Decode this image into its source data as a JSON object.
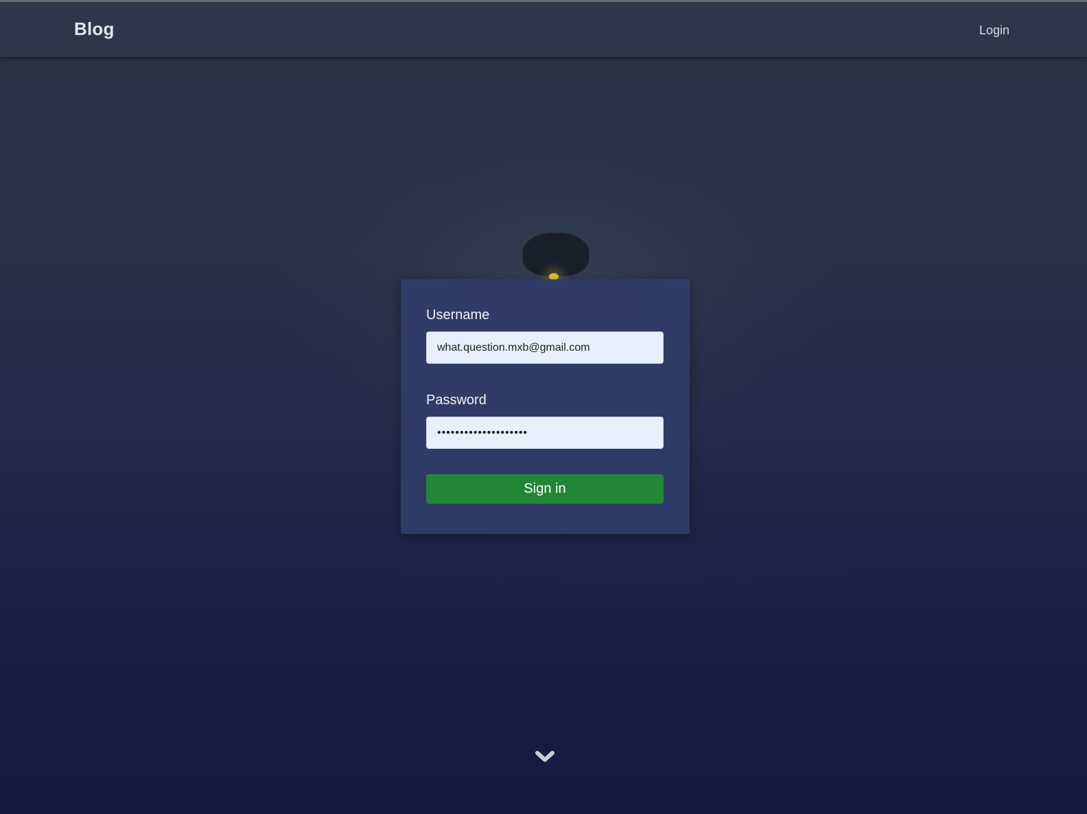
{
  "navbar": {
    "brand": "Blog",
    "login_link": "Login"
  },
  "login_form": {
    "username_label": "Username",
    "username_value": "what.question.mxb@gmail.com",
    "password_label": "Password",
    "password_value": "••••••••••••••••••••",
    "submit_label": "Sign in"
  },
  "icons": {
    "scroll_down": "chevron-down-icon"
  },
  "colors": {
    "navbar_bg": "#2c374d",
    "card_bg": "#303c68",
    "input_bg": "#e8f0fe",
    "submit_bg": "#238636",
    "page_bg_top": "#2a3447",
    "page_bg_bottom": "#141a3c"
  }
}
